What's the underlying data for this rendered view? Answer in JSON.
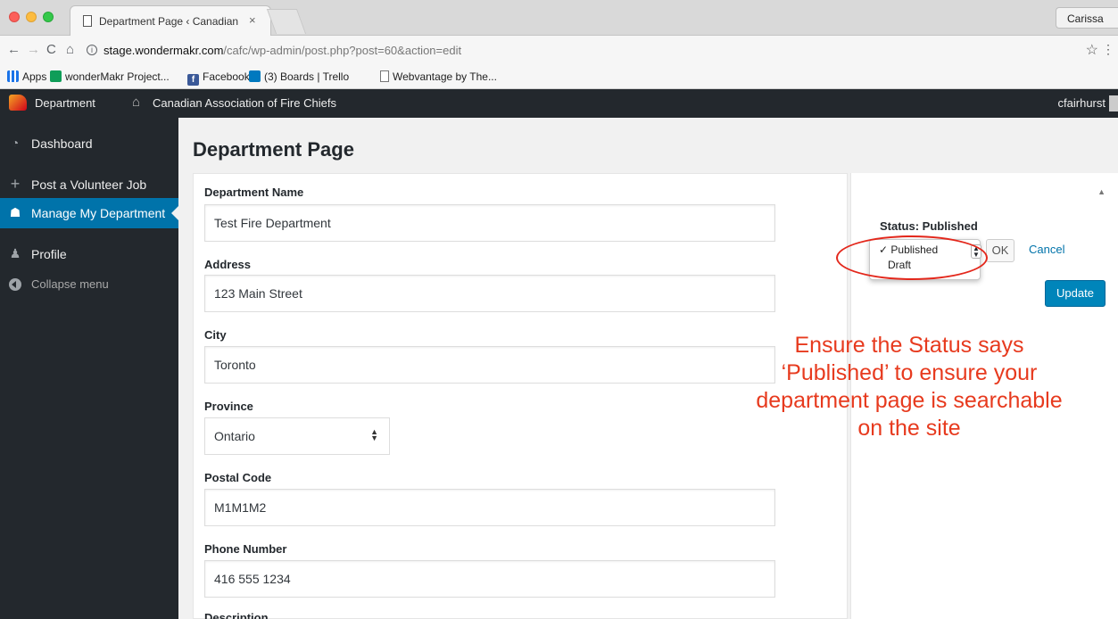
{
  "browser": {
    "tab_title": "Department Page ‹ Canadian",
    "tab_close": "×",
    "profile_name": "Carissa",
    "url_host": "stage.wondermakr.com",
    "url_path": "/cafc/wp-admin/post.php?post=60&action=edit",
    "bookmarks": [
      {
        "label": "Apps",
        "icon": "apps-icon"
      },
      {
        "label": "wonderMakr Project...",
        "icon": "sheets-icon"
      },
      {
        "label": "Facebook",
        "icon": "facebook-icon"
      },
      {
        "label": "(3) Boards | Trello",
        "icon": "trello-icon"
      },
      {
        "label": "Webvantage by The...",
        "icon": "document-icon"
      }
    ]
  },
  "adminbar": {
    "site_menu": "Department",
    "site_name": "Canadian Association of Fire Chiefs",
    "user": "cfairhurst"
  },
  "sidebar": {
    "items": [
      {
        "label": "Dashboard",
        "icon": "dashboard-icon"
      },
      {
        "label": "Post a Volunteer Job",
        "icon": "plus-icon"
      },
      {
        "label": "Manage My Department",
        "icon": "groups-icon",
        "active": true
      },
      {
        "label": "Profile",
        "icon": "user-icon"
      },
      {
        "label": "Collapse menu",
        "icon": "collapse-icon"
      }
    ]
  },
  "page": {
    "title": "Department Page"
  },
  "form": {
    "department_name_label": "Department Name",
    "department_name_value": "Test Fire Department",
    "address_label": "Address",
    "address_value": "123 Main Street",
    "city_label": "City",
    "city_value": "Toronto",
    "province_label": "Province",
    "province_value": "Ontario",
    "postal_code_label": "Postal Code",
    "postal_code_value": "M1M1M2",
    "phone_label": "Phone Number",
    "phone_value": "416 555 1234",
    "description_label": "Description"
  },
  "publish": {
    "status_text": "Status: Published",
    "options": [
      "Published",
      "Draft"
    ],
    "selected": "Published",
    "check_mark": "✓",
    "ok_label": "OK",
    "cancel_label": "Cancel",
    "update_label": "Update"
  },
  "annotation": {
    "text": "Ensure the Status says ‘Published’ to ensure your department page is searchable on the site",
    "color": "#e73a1e"
  },
  "colors": {
    "admin_dark": "#23282d",
    "accent": "#0073aa",
    "highlight": "#e3271b"
  }
}
